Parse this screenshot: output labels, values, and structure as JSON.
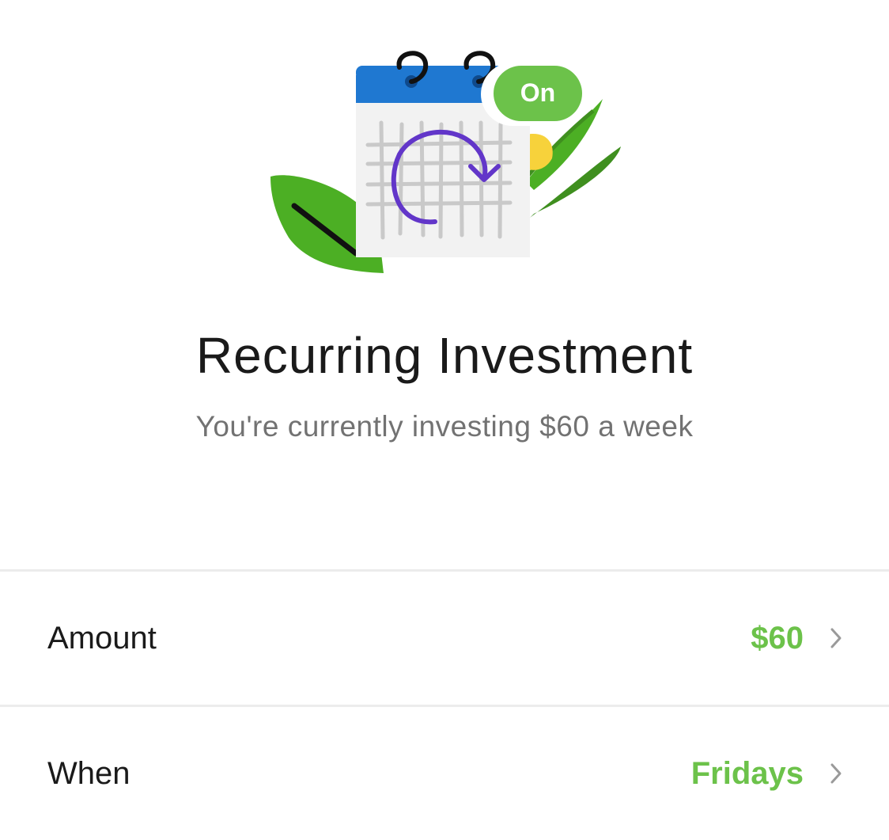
{
  "illustration": {
    "badge_label": "On",
    "colors": {
      "calendar_header": "#1f78d1",
      "calendar_body": "#f2f2f2",
      "grid": "#c9c9c9",
      "cycle_arrow": "#6236c9",
      "badge": "#6cc24a",
      "leaf": "#4caf24",
      "leaf_dark": "#3f8f1f",
      "flower": "#f7d23b"
    }
  },
  "page": {
    "title": "Recurring Investment",
    "subtitle": "You're currently investing $60 a week"
  },
  "settings": {
    "amount": {
      "label": "Amount",
      "value": "$60"
    },
    "when": {
      "label": "When",
      "value": "Fridays"
    }
  },
  "theme": {
    "accent": "#6cc24a",
    "divider": "#ececec",
    "chevron": "#9a9a9a"
  }
}
